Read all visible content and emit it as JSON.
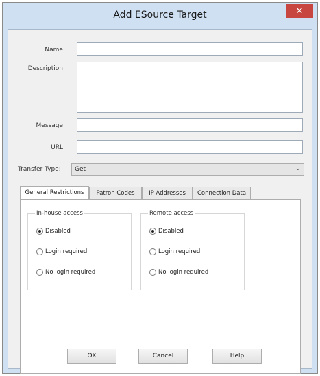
{
  "window": {
    "title": "Add ESource Target",
    "close_glyph": "✕"
  },
  "form": {
    "name_label": "Name:",
    "description_label": "Description:",
    "message_label": "Message:",
    "url_label": "URL:",
    "transfer_type_label": "Transfer Type:",
    "transfer_type_value": "Get",
    "name_value": "",
    "description_value": "",
    "message_value": "",
    "url_value": ""
  },
  "tabs": [
    {
      "label": "General Restrictions"
    },
    {
      "label": "Patron Codes"
    },
    {
      "label": "IP Addresses"
    },
    {
      "label": "Connection Data"
    }
  ],
  "inhouse": {
    "title": "In-house access",
    "options": [
      {
        "label": "Disabled",
        "selected": true
      },
      {
        "label": "Login required",
        "selected": false
      },
      {
        "label": "No login required",
        "selected": false
      }
    ]
  },
  "remote": {
    "title": "Remote access",
    "options": [
      {
        "label": "Disabled",
        "selected": true
      },
      {
        "label": "Login required",
        "selected": false
      },
      {
        "label": "No login required",
        "selected": false
      }
    ]
  },
  "buttons": {
    "ok": "OK",
    "cancel": "Cancel",
    "help": "Help"
  }
}
